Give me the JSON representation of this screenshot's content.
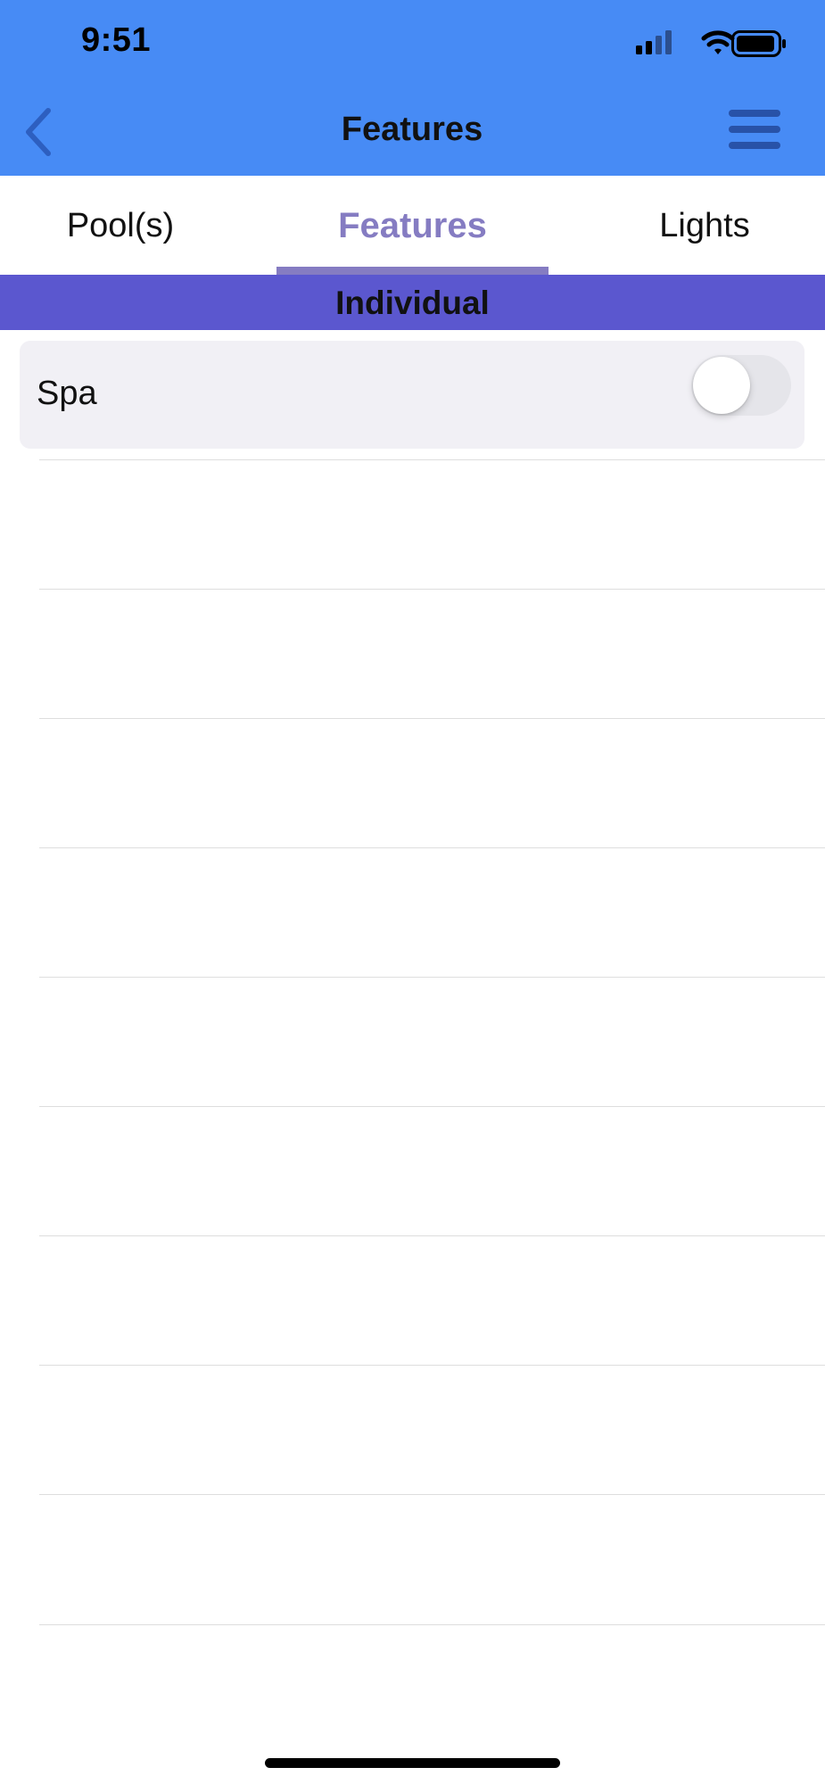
{
  "status_bar": {
    "time": "9:51"
  },
  "nav": {
    "title": "Features",
    "back_icon": "chevron-left-icon",
    "menu_icon": "hamburger-menu-icon"
  },
  "tabs": [
    {
      "label": "Pool(s)",
      "selected": false
    },
    {
      "label": "Features",
      "selected": true
    },
    {
      "label": "Lights",
      "selected": false
    }
  ],
  "section": {
    "title": "Individual"
  },
  "features": [
    {
      "label": "Spa",
      "on": false
    }
  ],
  "colors": {
    "header_bg": "#478bf5",
    "accent_tab": "#857cc2",
    "section_bg": "#5b57cf",
    "card_bg": "#f1f0f5",
    "back_icon": "#2d5fc0",
    "menu_icon": "#2852a8"
  }
}
